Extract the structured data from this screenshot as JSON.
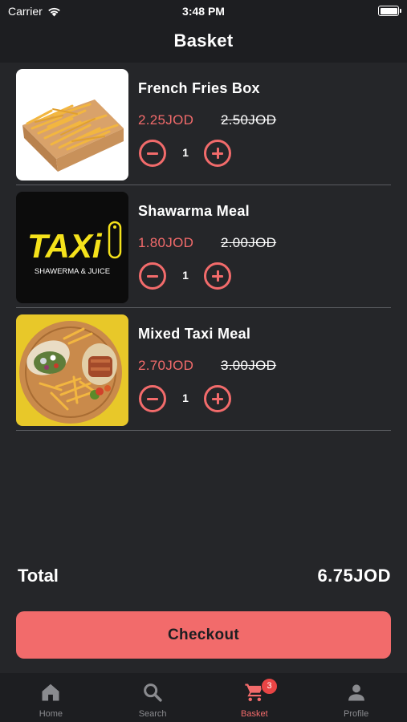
{
  "status_bar": {
    "carrier": "Carrier",
    "time": "3:48 PM"
  },
  "header": {
    "title": "Basket"
  },
  "basket": {
    "items": [
      {
        "name": "French Fries Box",
        "price": "2.25JOD",
        "old_price": "2.50JOD",
        "quantity": "1"
      },
      {
        "name": "Shawarma Meal",
        "price": "1.80JOD",
        "old_price": "2.00JOD",
        "quantity": "1",
        "logo_text": "TAXi",
        "logo_subtext": "SHAWERMA & JUICE"
      },
      {
        "name": "Mixed Taxi Meal",
        "price": "2.70JOD",
        "old_price": "3.00JOD",
        "quantity": "1"
      }
    ]
  },
  "total": {
    "label": "Total",
    "value": "6.75JOD"
  },
  "checkout": {
    "label": "Checkout"
  },
  "tab_bar": {
    "tabs": [
      {
        "label": "Home",
        "icon": "home-icon"
      },
      {
        "label": "Search",
        "icon": "search-icon"
      },
      {
        "label": "Basket",
        "icon": "cart-icon",
        "badge": "3",
        "active": true
      },
      {
        "label": "Profile",
        "icon": "person-icon"
      }
    ]
  },
  "colors": {
    "accent": "#f26b6b",
    "background": "#252629",
    "bar_background": "#1d1e21",
    "badge": "#e94545",
    "inactive_tab": "#8a8b8f"
  }
}
